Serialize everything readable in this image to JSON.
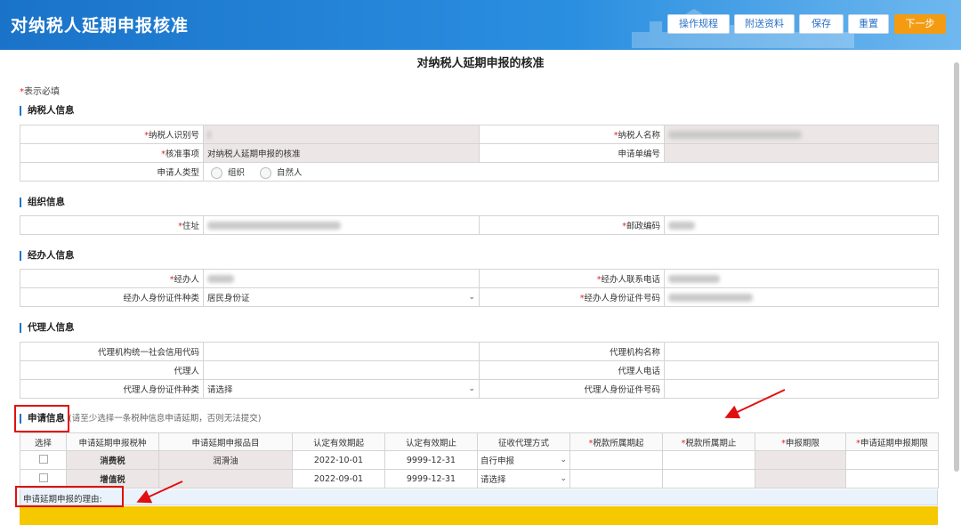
{
  "app": {
    "title": "对纳税人延期申报核准"
  },
  "toolbar": {
    "rules": "操作规程",
    "attach": "附送资料",
    "save": "保存",
    "reset": "重置",
    "next": "下一步"
  },
  "page": {
    "title": "对纳税人延期申报的核准",
    "required_note": "表示必填"
  },
  "taxpayer": {
    "section": "纳税人信息",
    "id_label": "纳税人识别号",
    "name_label": "纳税人名称",
    "item_label": "核准事项",
    "item_value": "对纳税人延期申报的核准",
    "app_no_label": "申请单编号",
    "type_label": "申请人类型",
    "type_opt1": "组织",
    "type_opt2": "自然人"
  },
  "org": {
    "section": "组织信息",
    "address_label": "住址",
    "postcode_label": "邮政编码"
  },
  "handler": {
    "section": "经办人信息",
    "name_label": "经办人",
    "phone_label": "经办人联系电话",
    "idtype_label": "经办人身份证件种类",
    "idtype_value": "居民身份证",
    "idno_label": "经办人身份证件号码"
  },
  "agent": {
    "section": "代理人信息",
    "credit_label": "代理机构统一社会信用代码",
    "org_name_label": "代理机构名称",
    "agent_label": "代理人",
    "phone_label": "代理人电话",
    "idtype_label": "代理人身份证件种类",
    "idtype_value": "请选择",
    "idno_label": "代理人身份证件号码"
  },
  "apply": {
    "section": "申请信息",
    "hint": "(请至少选择一条税种信息申请延期，否则无法提交)",
    "headers": [
      "选择",
      "申请延期申报税种",
      "申请延期申报品目",
      "认定有效期起",
      "认定有效期止",
      "征收代理方式",
      "税款所属期起",
      "税款所属期止",
      "申报期限",
      "申请延期申报期限"
    ],
    "required_cols": [
      6,
      7,
      8,
      9
    ],
    "rows": [
      {
        "tax": "消费税",
        "item": "润滑油",
        "start": "2022-10-01",
        "end": "9999-12-31",
        "mode": "自行申报"
      },
      {
        "tax": "增值税",
        "item": "",
        "start": "2022-09-01",
        "end": "9999-12-31",
        "mode": "请选择"
      }
    ],
    "reason_label": "申请延期申报的理由:"
  },
  "colors": {
    "accent": "#1a73c9",
    "next_button": "#f39c12",
    "highlight": "#e01010",
    "yellow_bar": "#f5c800"
  }
}
